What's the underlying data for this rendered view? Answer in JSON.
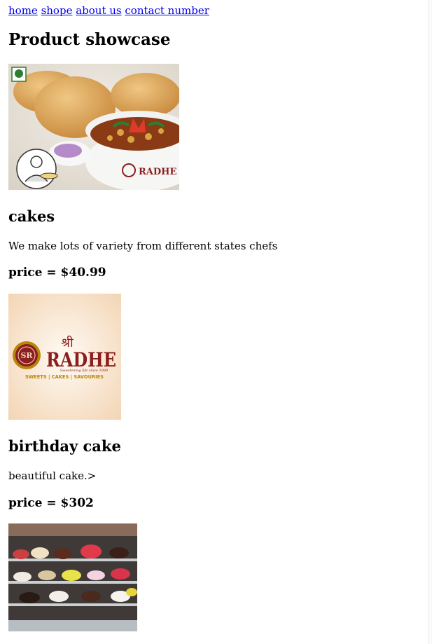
{
  "nav": [
    "home",
    "shope",
    "about us",
    "contact number"
  ],
  "page_title": "Product showcase",
  "logo": {
    "brand": "RADHE",
    "devanagari": "श्री",
    "tagline": "Sweetening life since 1980",
    "categories": "SWEETS | CAKES | SAVOURIES",
    "monogram": "SR"
  },
  "products": [
    {
      "name": "cakes",
      "description": "We make lots of variety from different states chefs",
      "price": "price = $40.99"
    },
    {
      "name": "birthday cake",
      "description": "beautiful cake.>",
      "price": "price = $302"
    }
  ],
  "colors": {
    "link": "#0000ee",
    "brand": "#8b1e1e",
    "gold": "#b8860b"
  }
}
